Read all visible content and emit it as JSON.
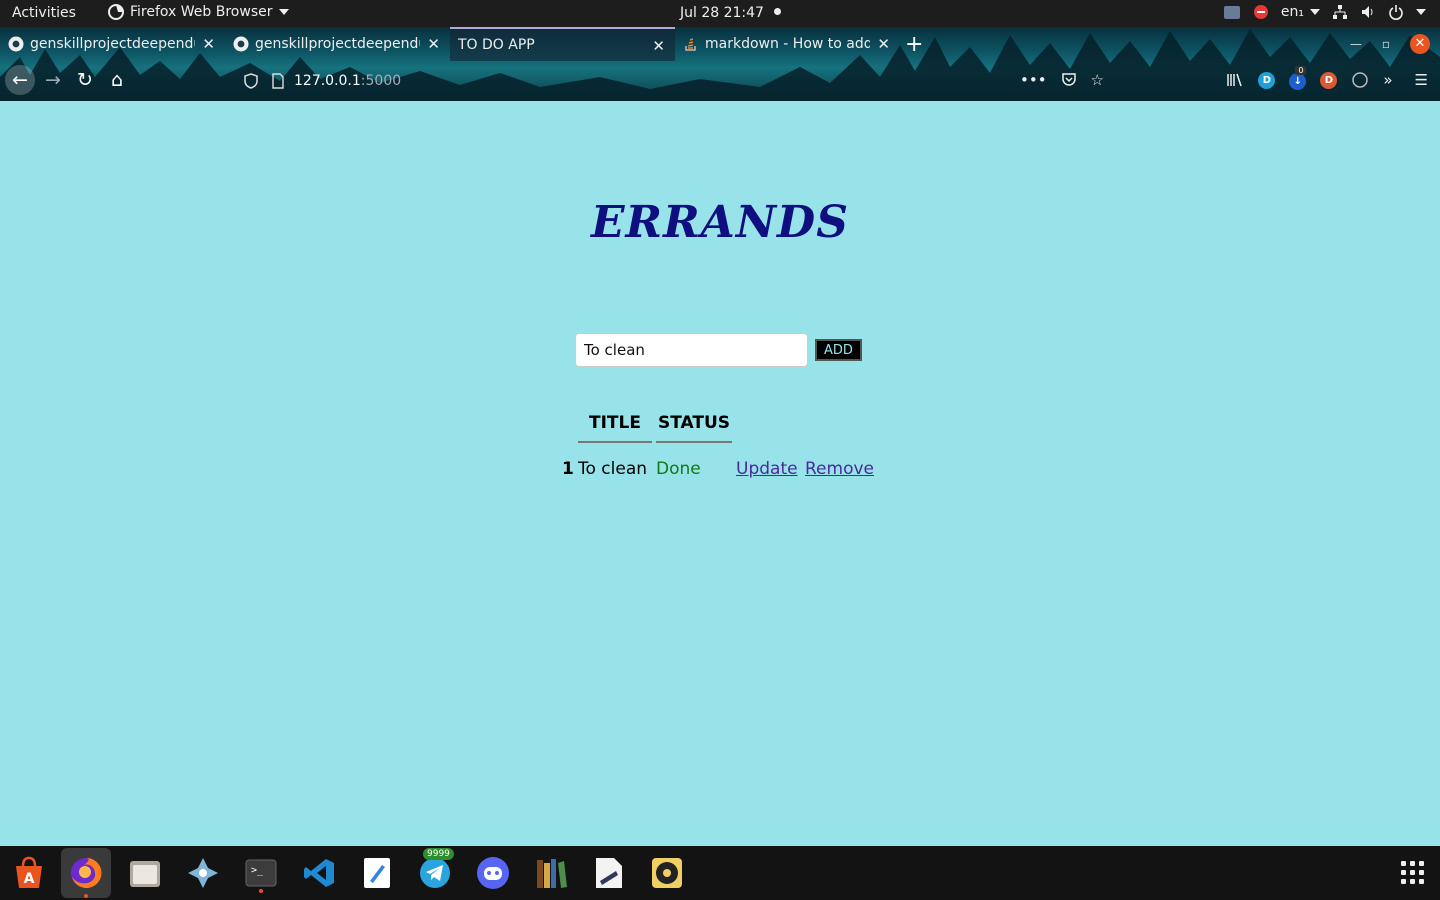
{
  "topbar": {
    "activities": "Activities",
    "app_name": "Firefox Web Browser",
    "clock": "Jul 28  21:47",
    "keyboard_layout": "en₁"
  },
  "browser": {
    "tabs": [
      {
        "title": "genskillprojectdeependu",
        "icon": "github-icon"
      },
      {
        "title": "genskillprojectdeependu",
        "icon": "github-icon"
      },
      {
        "title": "TO DO APP",
        "icon": "none",
        "active": true
      },
      {
        "title": "markdown - How to add",
        "icon": "stackoverflow-icon"
      }
    ],
    "url_host": "127.0.0.1",
    "url_port": ":5000",
    "pocket_badge": "0",
    "accent_close": "#e95420"
  },
  "page": {
    "heading": "ERRANDS",
    "input_value": "To clean",
    "add_label": "ADD",
    "columns": [
      "TITLE",
      "STATUS"
    ],
    "rows": [
      {
        "num": "1",
        "title": "To clean",
        "status": "Done",
        "update": "Update",
        "remove": "Remove"
      }
    ],
    "colors": {
      "background": "#98e3ea",
      "heading": "#0f0f80",
      "status_done": "#137a13",
      "link": "#4a2a9a"
    }
  },
  "dock": {
    "apps": [
      "ubuntu-software-icon",
      "firefox-icon",
      "files-icon",
      "ppsspp-icon",
      "terminal-icon",
      "vscode-icon",
      "text-editor-icon",
      "telegram-icon",
      "discord-icon",
      "calibre-icon",
      "libreoffice-icon",
      "rhythmbox-icon"
    ],
    "telegram_badge": "9999"
  }
}
